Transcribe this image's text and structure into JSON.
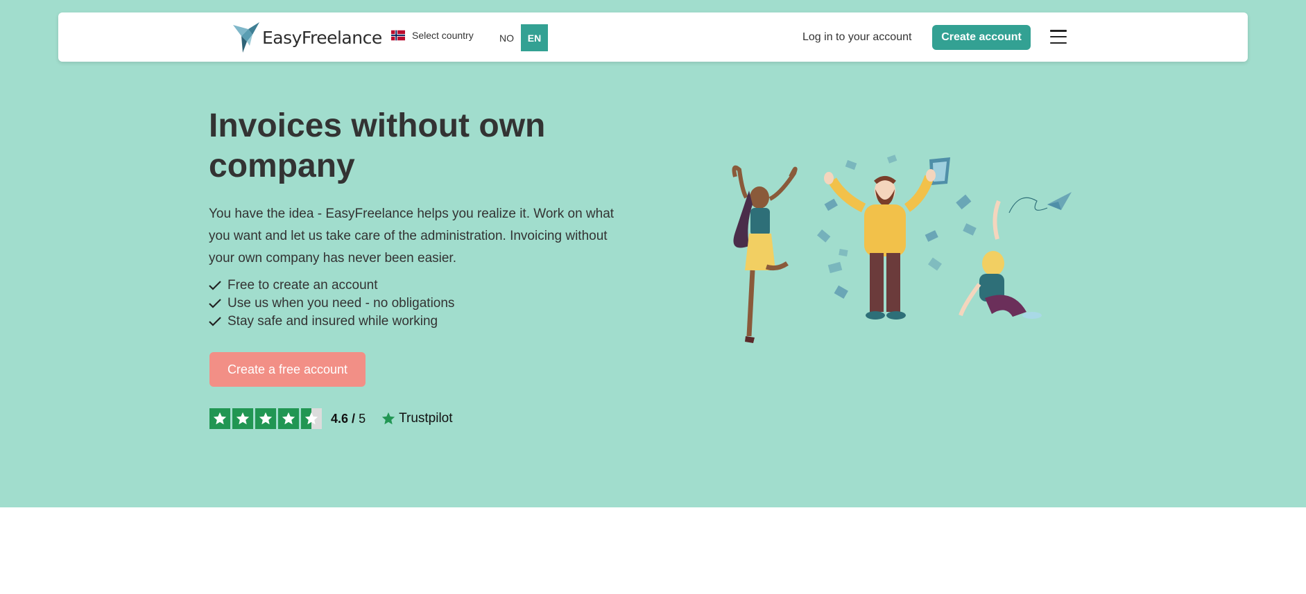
{
  "colors": {
    "hero_background": "#a1ddcd",
    "primary": "#33a193",
    "cta": "#f28f86",
    "trustpilot_green": "#219653",
    "text": "#333333"
  },
  "header": {
    "logo_text": "EasyFreelance",
    "country_selector": {
      "flag_icon": "norway-flag-icon",
      "label": "Select country"
    },
    "languages": [
      {
        "code": "NO",
        "active": false
      },
      {
        "code": "EN",
        "active": true
      }
    ],
    "login_label": "Log in to your account",
    "create_account_label": "Create account",
    "menu_icon": "hamburger-menu-icon"
  },
  "hero": {
    "title": "Invoices without own company",
    "description": "You have the idea - EasyFreelance helps you realize it. Work on what you want and let us take care of the administration. Invoicing without your own company has never been easier.",
    "bullets": [
      "Free to create an account",
      "Use us when you need - no obligations",
      "Stay safe and insured while working"
    ],
    "cta_label": "Create a free account",
    "rating": {
      "stars": 4.5,
      "score": "4.6",
      "separator": "/",
      "max": "5",
      "provider": "Trustpilot"
    }
  }
}
